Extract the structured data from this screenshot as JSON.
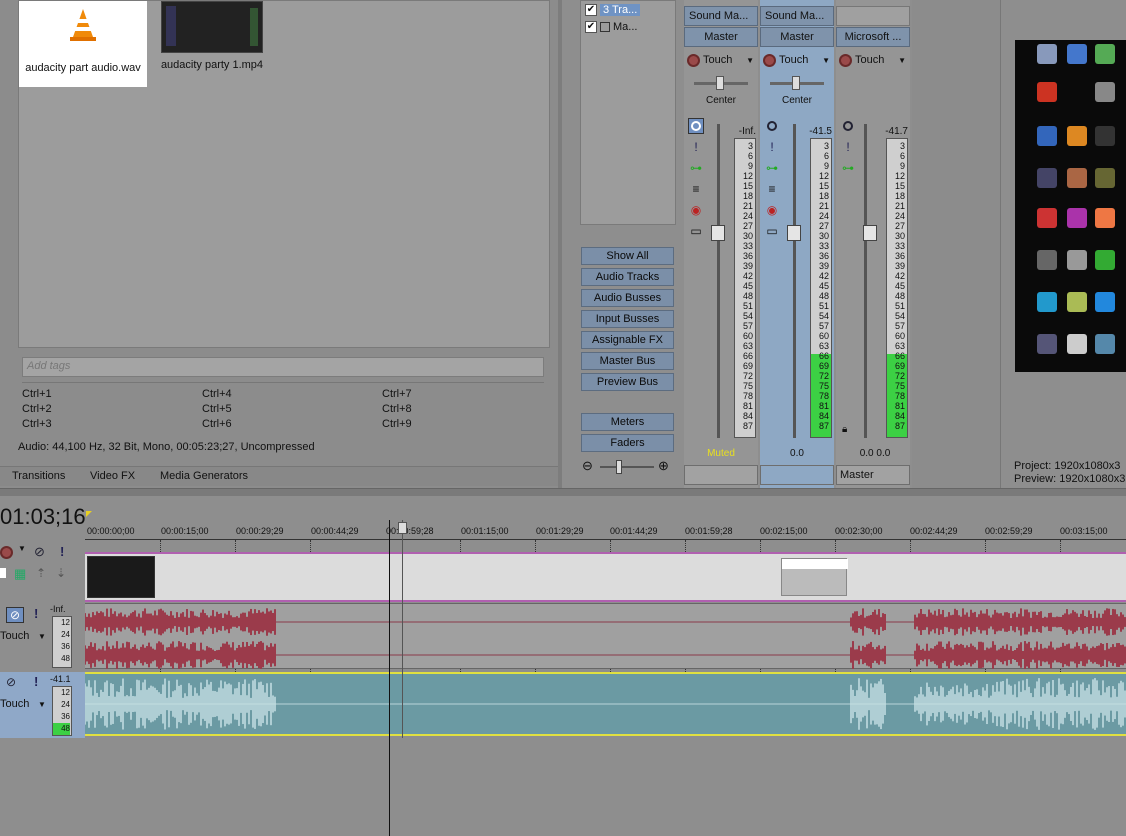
{
  "media": {
    "items": [
      {
        "name": "audacity part audio.wav",
        "icon": "vlc-cone-icon"
      },
      {
        "name": "audacity party 1.mp4",
        "icon": "video-thumbnail"
      }
    ],
    "tags_placeholder": "Add tags",
    "shortcuts": [
      "Ctrl+1",
      "Ctrl+4",
      "Ctrl+7",
      "Ctrl+2",
      "Ctrl+5",
      "Ctrl+8",
      "Ctrl+3",
      "Ctrl+6",
      "Ctrl+9"
    ],
    "audio_info": "Audio: 44,100 Hz, 32 Bit, Mono, 00:05:23;27, Uncompressed",
    "tabs": [
      "Transitions",
      "Video FX",
      "Media Generators"
    ]
  },
  "tree": {
    "rows": [
      {
        "label": "Tra...",
        "num": "3",
        "checked": "✔"
      },
      {
        "label": "Ma...",
        "checked": "✔"
      }
    ]
  },
  "mixer_filters": [
    "Show All",
    "Audio Tracks",
    "Audio Busses",
    "Input Busses",
    "Assignable FX",
    "Master Bus",
    "Preview Bus"
  ],
  "mixer_views": [
    "Meters",
    "Faders"
  ],
  "strips": [
    {
      "name": "Sound Ma...",
      "output": "Master",
      "automation": "Touch",
      "pan": "Center",
      "peak": "-Inf.",
      "status": "Muted",
      "footer": "",
      "meter_level": 0
    },
    {
      "name": "Sound Ma...",
      "output": "Master",
      "automation": "Touch",
      "pan": "Center",
      "peak": "-41.5",
      "status": "0.0",
      "footer": "",
      "meter_level": 0.28
    },
    {
      "name": "",
      "output": "Microsoft ...",
      "automation": "Touch",
      "pan": "",
      "peak": "-41.7",
      "status": "0.0     0.0",
      "footer": "Master",
      "meter_level": 0.28
    }
  ],
  "meter_scale": [
    "3",
    "6",
    "9",
    "12",
    "15",
    "18",
    "21",
    "24",
    "27",
    "30",
    "33",
    "36",
    "39",
    "42",
    "45",
    "48",
    "51",
    "54",
    "57",
    "60",
    "63",
    "66",
    "69",
    "72",
    "75",
    "78",
    "81",
    "84",
    "87"
  ],
  "project": {
    "project_label": "Project:",
    "project_value": "1920x1080x3",
    "preview_label": "Preview:",
    "preview_value": "1920x1080x3"
  },
  "timeline": {
    "timecode": "01:03;16",
    "ruler": [
      "00:00:00;00",
      "00:00:15;00",
      "00:00:29;29",
      "00:00:44;29",
      "00:00:59;28",
      "00:01:15;00",
      "00:01:29;29",
      "00:01:44;29",
      "00:01:59;28",
      "00:02:15;00",
      "00:02:30;00",
      "00:02:44;29",
      "00:02:59;29",
      "00:03:15;00"
    ],
    "tracks": [
      {
        "type": "video"
      },
      {
        "type": "audio",
        "peak": "-Inf.",
        "mode": "Touch",
        "scale": [
          "12",
          "24",
          "36",
          "48"
        ]
      },
      {
        "type": "audio",
        "peak": "-41.1",
        "mode": "Touch",
        "scale": [
          "12",
          "24",
          "36",
          "48"
        ]
      }
    ]
  },
  "colors": {
    "accent_blue": "#8ea8c4",
    "meter_green": "#3cd044",
    "muted_yellow": "#e8e020",
    "audio1_wave": "#9b3b4b",
    "audio2_bg": "#6b9aa3"
  }
}
